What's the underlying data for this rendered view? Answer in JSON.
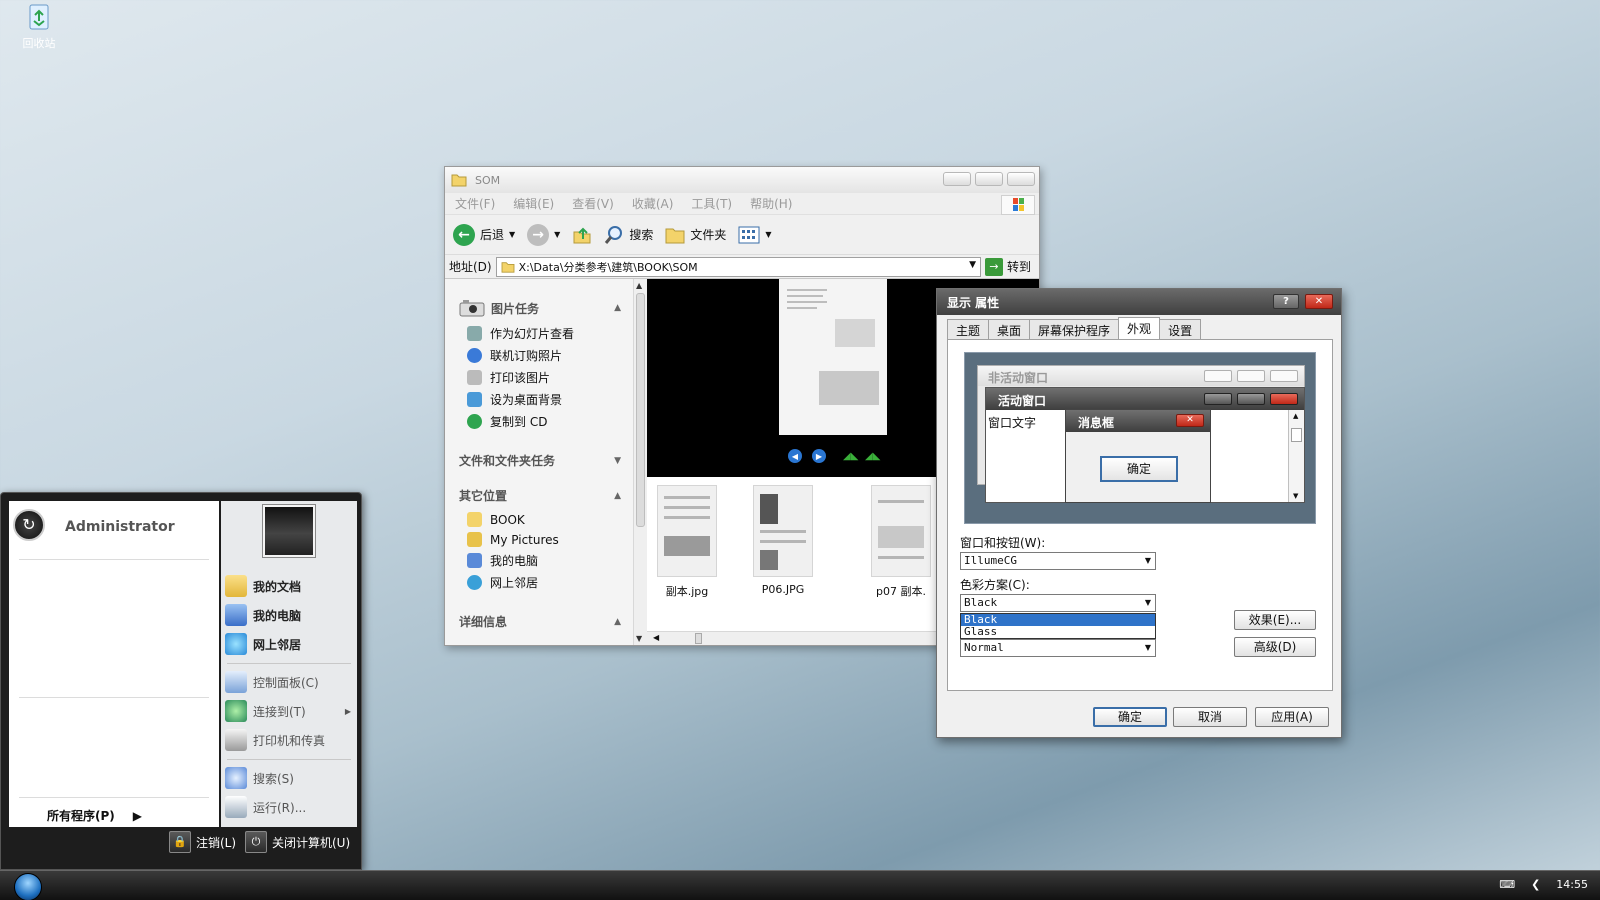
{
  "desktop": {
    "recycle_bin_label": "回收站"
  },
  "explorer": {
    "title": "SOM",
    "menu": [
      "文件(F)",
      "编辑(E)",
      "查看(V)",
      "收藏(A)",
      "工具(T)",
      "帮助(H)"
    ],
    "toolbar": {
      "back": "后退",
      "search": "搜索",
      "folders": "文件夹"
    },
    "address": {
      "label": "地址(D)",
      "path": "X:\\Data\\分类参考\\建筑\\BOOK\\SOM",
      "go": "转到"
    },
    "picture_tasks": {
      "title": "图片任务",
      "items": [
        "作为幻灯片查看",
        "联机订购照片",
        "打印该图片",
        "设为桌面背景",
        "复制到 CD"
      ]
    },
    "file_tasks_title": "文件和文件夹任务",
    "other_places": {
      "title": "其它位置",
      "items": [
        "BOOK",
        "My Pictures",
        "我的电脑",
        "网上邻居"
      ]
    },
    "details_title": "详细信息",
    "thumbnails": [
      "副本.jpg",
      "P06.JPG",
      "p07 副本."
    ]
  },
  "display_props": {
    "title": "显示 属性",
    "help": "?",
    "tabs": [
      "主题",
      "桌面",
      "屏幕保护程序",
      "外观",
      "设置"
    ],
    "active_tab_index": 3,
    "preview": {
      "inactive_window": "非活动窗口",
      "active_window": "活动窗口",
      "window_text": "窗口文字",
      "message_box": "消息框",
      "ok": "确定"
    },
    "windows_buttons_label": "窗口和按钮(W):",
    "windows_buttons_value": "IllumeCG",
    "color_scheme_label": "色彩方案(C):",
    "color_scheme_value": "Black",
    "color_scheme_options": [
      "Black",
      "Glass"
    ],
    "font_size_value": "Normal",
    "effects_button": "效果(E)...",
    "advanced_button": "高级(D)",
    "ok_button": "确定",
    "cancel_button": "取消",
    "apply_button": "应用(A)"
  },
  "start_menu": {
    "user": "Administrator",
    "all_programs": "所有程序(P)",
    "right_items_bold": [
      "我的文档",
      "我的电脑",
      "网上邻居"
    ],
    "right_items": [
      "控制面板(C)",
      "连接到(T)",
      "打印机和传真",
      "搜索(S)",
      "运行(R)..."
    ],
    "logoff": "注销(L)",
    "shutdown": "关闭计算机(U)"
  },
  "taskbar": {
    "clock": "14:55"
  },
  "colors": {
    "accent_blue": "#2f73c9",
    "title_dark": "#404040",
    "close_red": "#c02818"
  }
}
